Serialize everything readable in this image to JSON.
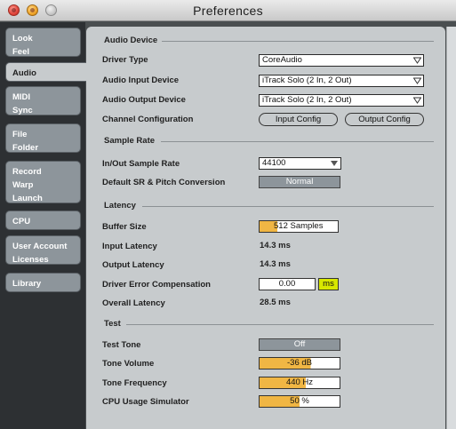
{
  "window": {
    "title": "Preferences"
  },
  "sidebar": {
    "tabs": [
      {
        "lines": [
          "Look",
          "Feel"
        ],
        "active": false
      },
      {
        "lines": [
          "Audio"
        ],
        "active": true
      },
      {
        "lines": [
          "MIDI",
          "Sync"
        ],
        "active": false
      },
      {
        "lines": [
          "File",
          "Folder"
        ],
        "active": false
      },
      {
        "lines": [
          "Record",
          "Warp",
          "Launch"
        ],
        "active": false
      },
      {
        "lines": [
          "CPU"
        ],
        "active": false
      },
      {
        "lines": [
          "User Account",
          "Licenses"
        ],
        "active": false
      },
      {
        "lines": [
          "Library"
        ],
        "active": false
      }
    ]
  },
  "audio_device": {
    "heading": "Audio Device",
    "driver_type_label": "Driver Type",
    "driver_type_value": "CoreAudio",
    "input_device_label": "Audio Input Device",
    "input_device_value": "iTrack Solo (2 In, 2 Out)",
    "output_device_label": "Audio Output Device",
    "output_device_value": "iTrack Solo (2 In, 2 Out)",
    "channel_config_label": "Channel Configuration",
    "input_config_button": "Input Config",
    "output_config_button": "Output Config"
  },
  "sample_rate": {
    "heading": "Sample Rate",
    "rate_label": "In/Out Sample Rate",
    "rate_value": "44100",
    "conversion_label": "Default SR & Pitch Conversion",
    "conversion_value": "Normal"
  },
  "latency": {
    "heading": "Latency",
    "buffer_label": "Buffer Size",
    "buffer_value": "512 Samples",
    "input_latency_label": "Input Latency",
    "input_latency_value": "14.3 ms",
    "output_latency_label": "Output Latency",
    "output_latency_value": "14.3 ms",
    "driver_comp_label": "Driver Error Compensation",
    "driver_comp_value": "0.00",
    "driver_comp_unit": "ms",
    "overall_label": "Overall Latency",
    "overall_value": "28.5 ms"
  },
  "test": {
    "heading": "Test",
    "tone_label": "Test Tone",
    "tone_value": "Off",
    "volume_label": "Tone Volume",
    "volume_value": "-36 dB",
    "frequency_label": "Tone Frequency",
    "frequency_value": "440 Hz",
    "cpu_label": "CPU Usage Simulator",
    "cpu_value": "50 %"
  },
  "colors": {
    "accent_orange": "#f0b644",
    "unit_yellow": "#d8e800",
    "panel": "#c7cbcd",
    "sidebar": "#2d3033"
  }
}
